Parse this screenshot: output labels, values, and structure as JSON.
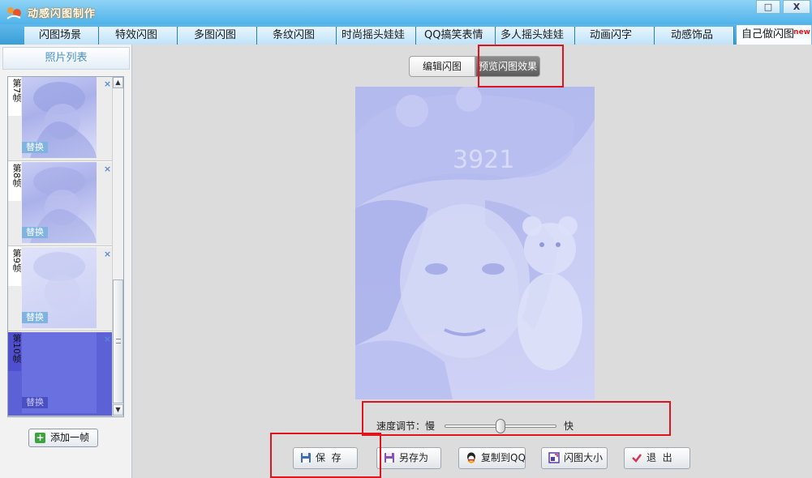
{
  "app": {
    "title": "动感闪图制作",
    "window_controls": {
      "maximize": "□",
      "close": "X"
    }
  },
  "tabs": [
    {
      "label": "闪图场景",
      "active": false
    },
    {
      "label": "特效闪图",
      "active": false
    },
    {
      "label": "多图闪图",
      "active": false
    },
    {
      "label": "条纹闪图",
      "active": false
    },
    {
      "label": "时尚摇头娃娃",
      "active": false
    },
    {
      "label": "QQ搞笑表情",
      "active": false
    },
    {
      "label": "多人摇头娃娃",
      "active": false
    },
    {
      "label": "动画闪字",
      "active": false
    },
    {
      "label": "动感饰品",
      "active": false
    },
    {
      "label": "自己做闪图",
      "active": true,
      "badge": "new"
    }
  ],
  "left_panel": {
    "header": "照片列表",
    "frames": [
      {
        "label": "第7帧",
        "replace": "替换",
        "close": "×",
        "selected": false
      },
      {
        "label": "第8帧",
        "replace": "替换",
        "close": "×",
        "selected": false
      },
      {
        "label": "第9帧",
        "replace": "替换",
        "close": "×",
        "selected": false
      },
      {
        "label": "第10帧",
        "replace": "替换",
        "close": "×",
        "selected": true
      }
    ],
    "scroll": {
      "up": "▲",
      "down": "▼"
    },
    "add_frame_label": "添加一帧",
    "add_frame_icon": "+"
  },
  "main": {
    "mode_tabs": {
      "edit": "编辑闪图",
      "preview": "预览闪图效果"
    },
    "preview_text": "3921",
    "speed": {
      "label": "速度调节：慢",
      "fast": "快",
      "level": 0.5
    },
    "buttons": {
      "save": "保  存",
      "save_as": "另存为",
      "copy_qq": "复制到QQ",
      "size": "闪图大小",
      "exit": "退  出"
    }
  },
  "colors": {
    "title_bar": "#4fb3ea",
    "selected_frame": "#5c62d6",
    "preview_tint": "#c8ccf3",
    "highlight": "#e0141c"
  }
}
